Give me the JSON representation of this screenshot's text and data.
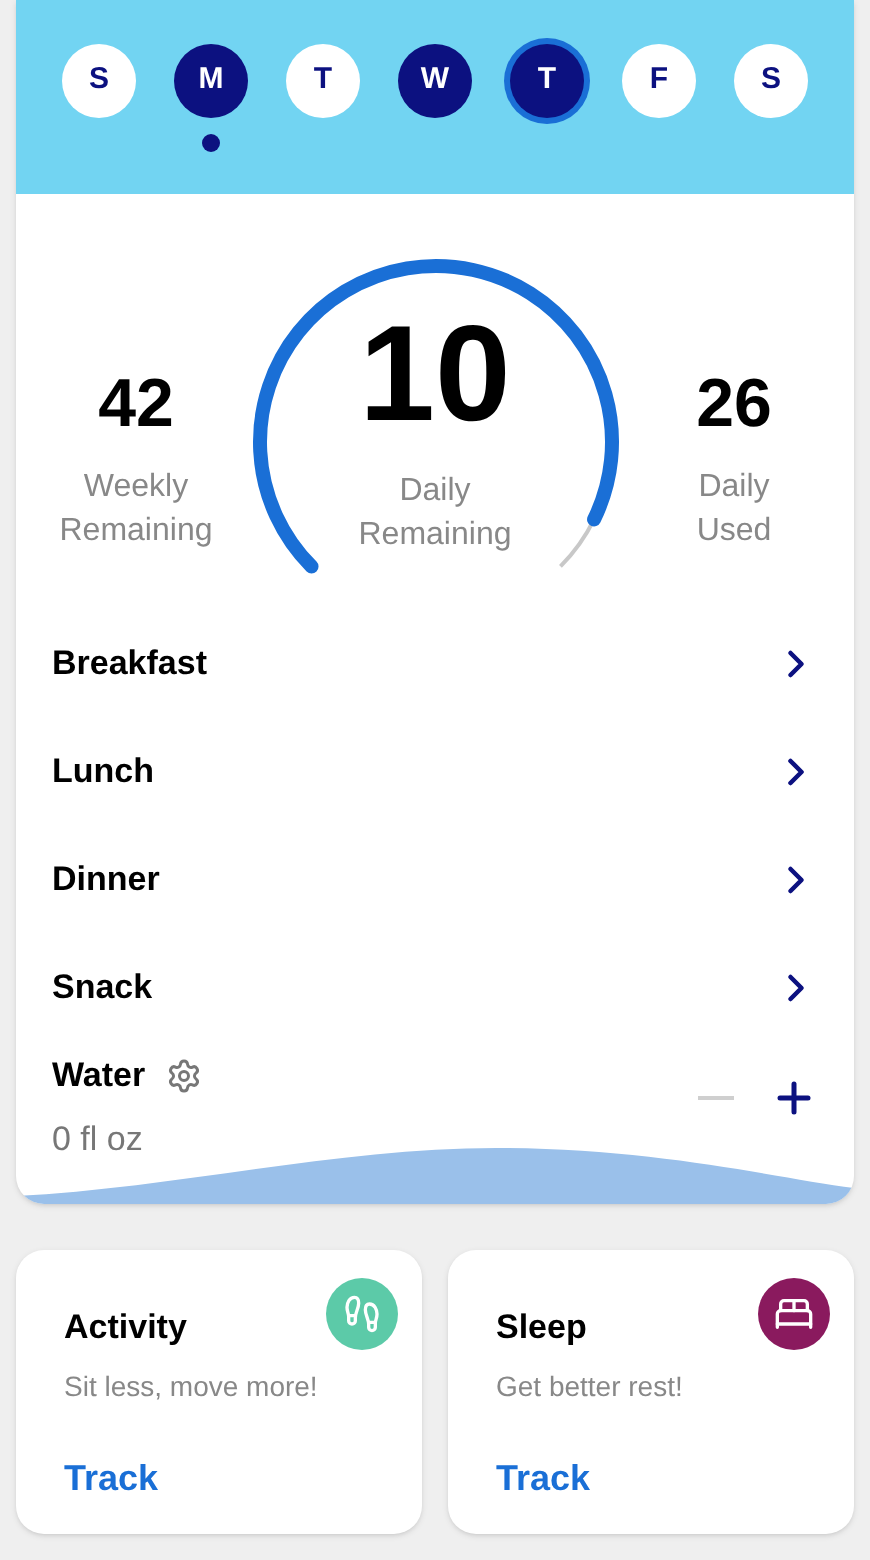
{
  "days": [
    {
      "label": "S",
      "filled": false,
      "selected": false,
      "marked": false
    },
    {
      "label": "M",
      "filled": true,
      "selected": false,
      "marked": true
    },
    {
      "label": "T",
      "filled": false,
      "selected": false,
      "marked": false
    },
    {
      "label": "W",
      "filled": true,
      "selected": false,
      "marked": false
    },
    {
      "label": "T",
      "filled": true,
      "selected": true,
      "marked": false
    },
    {
      "label": "F",
      "filled": false,
      "selected": false,
      "marked": false
    },
    {
      "label": "S",
      "filled": false,
      "selected": false,
      "marked": false
    }
  ],
  "summary": {
    "left": {
      "value": "42",
      "label": "Weekly Remaining"
    },
    "center": {
      "value": "10",
      "label": "Daily Remaining"
    },
    "right": {
      "value": "26",
      "label": "Daily Used"
    }
  },
  "meals": [
    {
      "label": "Breakfast"
    },
    {
      "label": "Lunch"
    },
    {
      "label": "Dinner"
    },
    {
      "label": "Snack"
    }
  ],
  "water": {
    "label": "Water",
    "amount": "0 fl oz",
    "decrease_disabled": true
  },
  "cards": [
    {
      "title": "Activity",
      "subtitle": "Sit less, move more!",
      "action": "Track",
      "kind": "activity",
      "color": "#5ccaa8"
    },
    {
      "title": "Sleep",
      "subtitle": "Get better rest!",
      "action": "Track",
      "kind": "sleep",
      "color": "#8a1a5e"
    }
  ]
}
